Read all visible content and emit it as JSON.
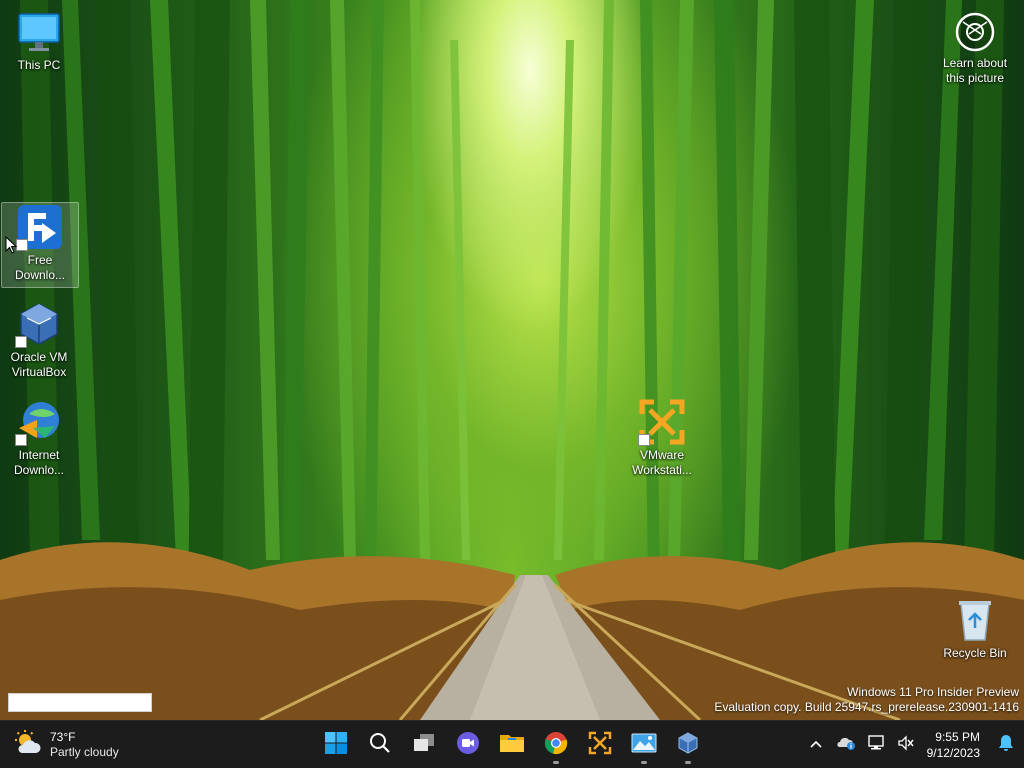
{
  "desktop": {
    "icons": [
      {
        "name": "This PC",
        "icon": "monitor-icon"
      },
      {
        "name": "Free Downlo...",
        "icon": "free-download-manager-icon"
      },
      {
        "name": "Oracle VM VirtualBox",
        "icon": "virtualbox-icon"
      },
      {
        "name": "Internet Downlo...",
        "icon": "internet-download-manager-icon"
      },
      {
        "name": "VMware Workstati...",
        "icon": "vmware-icon"
      },
      {
        "name": "Recycle Bin",
        "icon": "recycle-bin-icon"
      }
    ],
    "spotlight": {
      "label": "Learn about this picture",
      "icon": "camera-lens-icon"
    },
    "watermark": {
      "line1": "Windows 11 Pro Insider Preview",
      "line2": "Evaluation copy. Build 25947.rs_prerelease.230901-1416"
    }
  },
  "taskbar": {
    "weather": {
      "temp": "73°F",
      "condition": "Partly cloudy",
      "icon": "partly-cloudy-icon"
    },
    "apps": [
      {
        "name": "Start",
        "icon": "windows-start-icon",
        "running": false
      },
      {
        "name": "Search",
        "icon": "search-icon",
        "running": false
      },
      {
        "name": "Task View",
        "icon": "task-view-icon",
        "running": false
      },
      {
        "name": "Chat",
        "icon": "chat-icon",
        "running": false
      },
      {
        "name": "File Explorer",
        "icon": "folder-icon",
        "running": false
      },
      {
        "name": "Google Chrome",
        "icon": "chrome-icon",
        "running": true
      },
      {
        "name": "VMware Workstation",
        "icon": "vmware-icon",
        "running": false
      },
      {
        "name": "Photos",
        "icon": "photos-icon",
        "running": true
      },
      {
        "name": "Oracle VM VirtualBox",
        "icon": "virtualbox-icon",
        "running": true
      }
    ],
    "tray": {
      "overflow_icon": "chevron-up-icon",
      "icons": [
        "onedrive-info-icon",
        "network-icon",
        "volume-muted-icon"
      ],
      "time": "9:55 PM",
      "date": "9/12/2023",
      "notification_icon": "bell-icon"
    }
  },
  "colors": {
    "taskbar_bg": "#1c1c1c",
    "accent": "#0078d4",
    "vmware_orange": "#f5a623"
  }
}
